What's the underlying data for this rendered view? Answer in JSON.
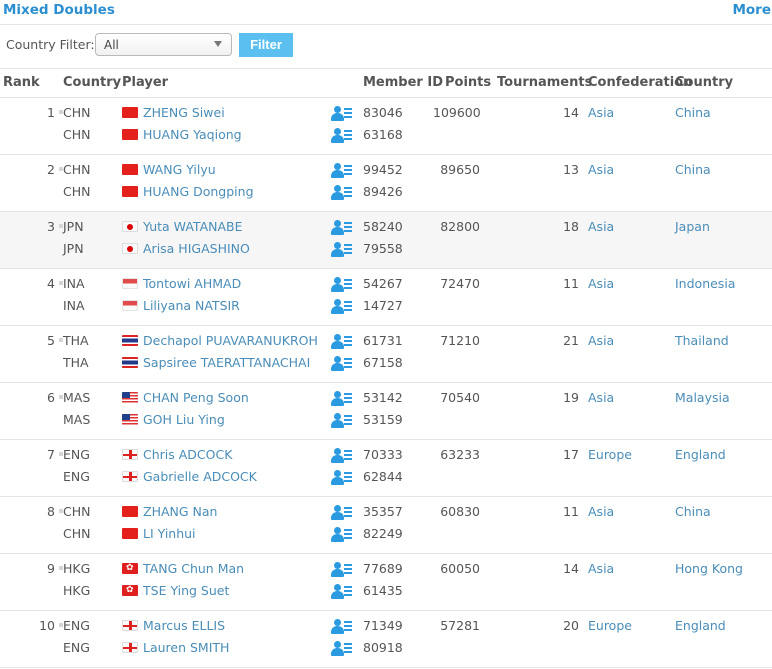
{
  "header": {
    "title": "Mixed Doubles",
    "more_label": "More"
  },
  "filter": {
    "label": "Country Filter:",
    "selected": "All",
    "button_label": "Filter"
  },
  "table": {
    "columns": [
      "Rank",
      "Country",
      "Player",
      "Member ID",
      "Points",
      "Tournaments",
      "Confederation",
      "Country"
    ],
    "rows": [
      {
        "rank": "1",
        "points": "109600",
        "tournaments": "14",
        "confederation": "Asia",
        "country": "China",
        "players": [
          {
            "code": "CHN",
            "flag": "chn",
            "name": "ZHENG Siwei",
            "member_id": "83046"
          },
          {
            "code": "CHN",
            "flag": "chn",
            "name": "HUANG Yaqiong",
            "member_id": "63168"
          }
        ]
      },
      {
        "rank": "2",
        "points": "89650",
        "tournaments": "13",
        "confederation": "Asia",
        "country": "China",
        "players": [
          {
            "code": "CHN",
            "flag": "chn",
            "name": "WANG Yilyu",
            "member_id": "99452"
          },
          {
            "code": "CHN",
            "flag": "chn",
            "name": "HUANG Dongping",
            "member_id": "89426"
          }
        ]
      },
      {
        "rank": "3",
        "points": "82800",
        "tournaments": "18",
        "confederation": "Asia",
        "country": "Japan",
        "players": [
          {
            "code": "JPN",
            "flag": "jpn",
            "name": "Yuta WATANABE",
            "member_id": "58240"
          },
          {
            "code": "JPN",
            "flag": "jpn",
            "name": "Arisa HIGASHINO",
            "member_id": "79558"
          }
        ]
      },
      {
        "rank": "4",
        "points": "72470",
        "tournaments": "11",
        "confederation": "Asia",
        "country": "Indonesia",
        "players": [
          {
            "code": "INA",
            "flag": "ina",
            "name": "Tontowi AHMAD",
            "member_id": "54267"
          },
          {
            "code": "INA",
            "flag": "ina",
            "name": "Liliyana NATSIR",
            "member_id": "14727"
          }
        ]
      },
      {
        "rank": "5",
        "points": "71210",
        "tournaments": "21",
        "confederation": "Asia",
        "country": "Thailand",
        "players": [
          {
            "code": "THA",
            "flag": "tha",
            "name": "Dechapol PUAVARANUKROH",
            "member_id": "61731"
          },
          {
            "code": "THA",
            "flag": "tha",
            "name": "Sapsiree TAERATTANACHAI",
            "member_id": "67158"
          }
        ]
      },
      {
        "rank": "6",
        "points": "70540",
        "tournaments": "19",
        "confederation": "Asia",
        "country": "Malaysia",
        "players": [
          {
            "code": "MAS",
            "flag": "mas",
            "name": "CHAN Peng Soon",
            "member_id": "53142"
          },
          {
            "code": "MAS",
            "flag": "mas",
            "name": "GOH Liu Ying",
            "member_id": "53159"
          }
        ]
      },
      {
        "rank": "7",
        "points": "63233",
        "tournaments": "17",
        "confederation": "Europe",
        "country": "England",
        "players": [
          {
            "code": "ENG",
            "flag": "eng",
            "name": "Chris ADCOCK",
            "member_id": "70333"
          },
          {
            "code": "ENG",
            "flag": "eng",
            "name": "Gabrielle ADCOCK",
            "member_id": "62844"
          }
        ]
      },
      {
        "rank": "8",
        "points": "60830",
        "tournaments": "11",
        "confederation": "Asia",
        "country": "China",
        "players": [
          {
            "code": "CHN",
            "flag": "chn",
            "name": "ZHANG Nan",
            "member_id": "35357"
          },
          {
            "code": "CHN",
            "flag": "chn",
            "name": "LI Yinhui",
            "member_id": "82249"
          }
        ]
      },
      {
        "rank": "9",
        "points": "60050",
        "tournaments": "14",
        "confederation": "Asia",
        "country": "Hong Kong",
        "players": [
          {
            "code": "HKG",
            "flag": "hkg",
            "name": "TANG Chun Man",
            "member_id": "77689"
          },
          {
            "code": "HKG",
            "flag": "hkg",
            "name": "TSE Ying Suet",
            "member_id": "61435"
          }
        ]
      },
      {
        "rank": "10",
        "points": "57281",
        "tournaments": "20",
        "confederation": "Europe",
        "country": "England",
        "players": [
          {
            "code": "ENG",
            "flag": "eng",
            "name": "Marcus ELLIS",
            "member_id": "71349"
          },
          {
            "code": "ENG",
            "flag": "eng",
            "name": "Lauren SMITH",
            "member_id": "80918"
          }
        ]
      }
    ]
  },
  "icons": {
    "rank_indicator": "rank-change-dot-icon",
    "profile": "player-profile-icon",
    "dropdown": "chevron-down-icon"
  },
  "colors": {
    "accent": "#2b8fd1",
    "link": "#4a8db8",
    "filter_button": "#5bc0f0",
    "profile_icon": "#2a9be0",
    "shaded_row": "#f6f6f6"
  }
}
